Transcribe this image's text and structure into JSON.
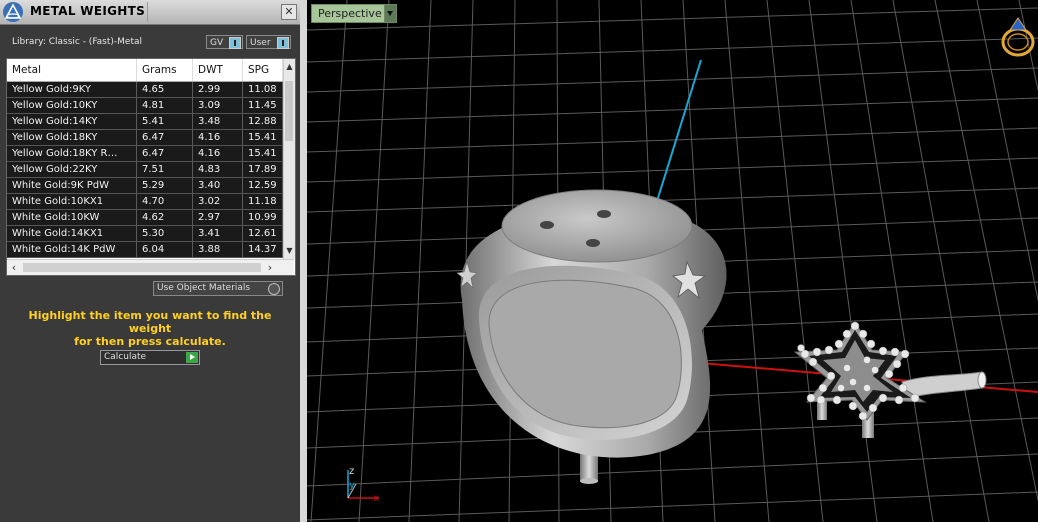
{
  "panel": {
    "title": "METAL WEIGHTS",
    "close": "✕",
    "library_label": "Library: Classic - (Fast)-Metal",
    "filter_gv": "GV",
    "filter_user": "User",
    "columns": [
      "Metal",
      "Grams",
      "DWT",
      "SPG"
    ],
    "rows": [
      [
        "Yellow Gold:9KY",
        "4.65",
        "2.99",
        "11.08"
      ],
      [
        "Yellow Gold:10KY",
        "4.81",
        "3.09",
        "11.45"
      ],
      [
        "Yellow Gold:14KY",
        "5.41",
        "3.48",
        "12.88"
      ],
      [
        "Yellow Gold:18KY",
        "6.47",
        "4.16",
        "15.41"
      ],
      [
        "Yellow Gold:18KY R…",
        "6.47",
        "4.16",
        "15.41"
      ],
      [
        "Yellow Gold:22KY",
        "7.51",
        "4.83",
        "17.89"
      ],
      [
        "White Gold:9K PdW",
        "5.29",
        "3.40",
        "12.59"
      ],
      [
        "White Gold:10KX1",
        "4.70",
        "3.02",
        "11.18"
      ],
      [
        "White Gold:10KW",
        "4.62",
        "2.97",
        "10.99"
      ],
      [
        "White Gold:14KX1",
        "5.30",
        "3.41",
        "12.61"
      ],
      [
        "White Gold:14K PdW",
        "6.04",
        "3.88",
        "14.37"
      ]
    ],
    "use_object_materials": "Use Object Materials",
    "instruction_line1": "Highlight the item you want to find the weight",
    "instruction_line2": "for then press calculate.",
    "calculate_label": "Calculate"
  },
  "viewport": {
    "view_mode": "Perspective",
    "axis_labels": {
      "z": "z",
      "y": "y",
      "x": "x"
    },
    "colors": {
      "x_axis": "#d01010",
      "y_axis": "#17a8d6",
      "grid": "#5a5a5a",
      "gizmo": "#e2a73a"
    }
  }
}
